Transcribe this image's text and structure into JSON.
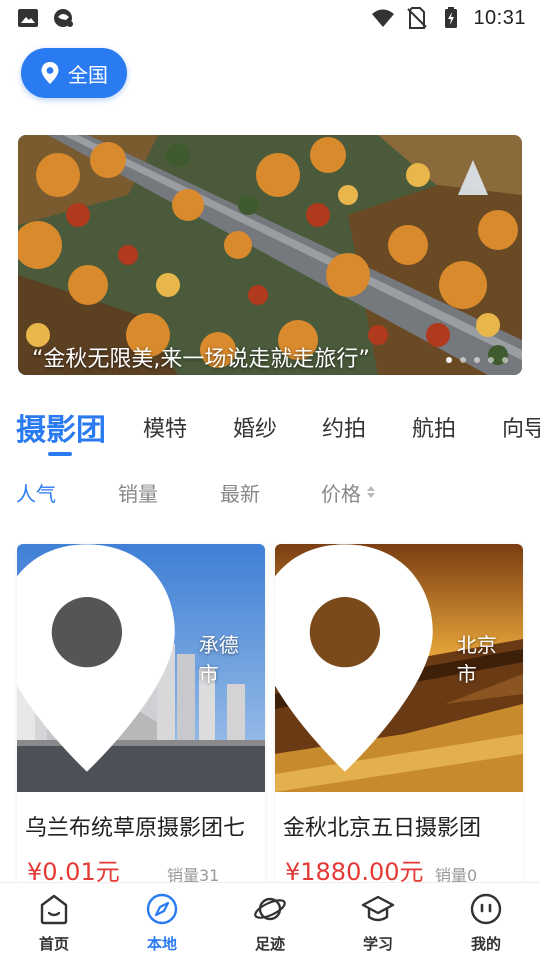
{
  "status_bar": {
    "time": "10:31",
    "left_icons": [
      "image-icon",
      "app-notification-icon"
    ],
    "right_icons": [
      "wifi-icon",
      "no-sim-icon",
      "battery-charging-icon"
    ]
  },
  "location": {
    "label": "全国",
    "icon": "location-pin-icon"
  },
  "banner": {
    "caption": "“金秋无限美,来一场说走就走旅行”",
    "slide_count": 5,
    "active_slide": 1
  },
  "category_tabs": [
    {
      "label": "摄影团",
      "active": true
    },
    {
      "label": "模特"
    },
    {
      "label": "婚纱"
    },
    {
      "label": "约拍"
    },
    {
      "label": "航拍"
    },
    {
      "label": "向导"
    }
  ],
  "sort_bar": [
    {
      "label": "人气",
      "active": true
    },
    {
      "label": "销量"
    },
    {
      "label": "最新"
    },
    {
      "label": "价格",
      "icon": "sort-arrows-icon"
    }
  ],
  "products": [
    {
      "title": "乌兰布统草原摄影团七",
      "city": "承德市",
      "price": "¥0.01元",
      "sales": "销量31"
    },
    {
      "title": "金秋北京五日摄影团",
      "city": "北京市",
      "price": "¥1880.00元",
      "sales": "销量0"
    }
  ],
  "bottom_nav": [
    {
      "label": "首页",
      "icon": "home-icon"
    },
    {
      "label": "本地",
      "icon": "compass-icon",
      "active": true
    },
    {
      "label": "足迹",
      "icon": "planet-icon"
    },
    {
      "label": "学习",
      "icon": "graduation-cap-icon"
    },
    {
      "label": "我的",
      "icon": "profile-face-icon"
    }
  ],
  "colors": {
    "accent": "#2a7bf1",
    "price": "#e53935",
    "muted": "#999999"
  }
}
